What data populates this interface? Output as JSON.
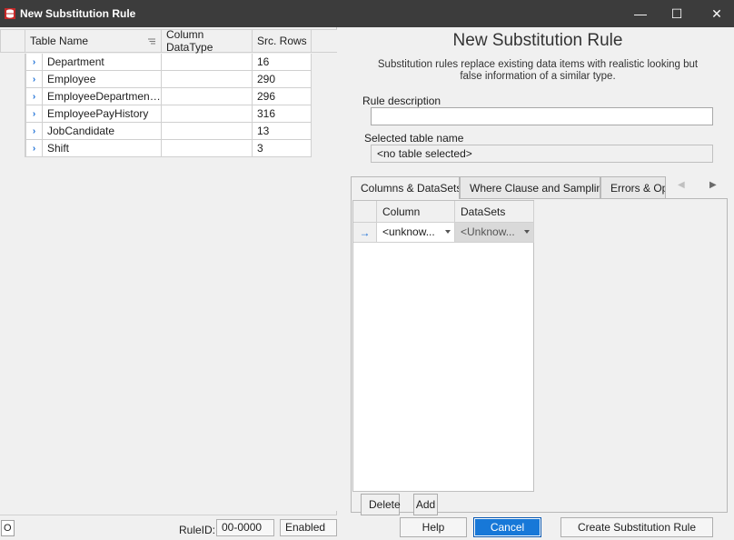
{
  "window": {
    "title": "New Substitution Rule",
    "minimize": "—",
    "maximize": "☐",
    "close": "✕"
  },
  "left_grid": {
    "columns": [
      "Table Name",
      "Column DataType",
      "Src. Rows"
    ],
    "rows": [
      {
        "name": "Department",
        "type": "",
        "rows": "16"
      },
      {
        "name": "Employee",
        "type": "",
        "rows": "290"
      },
      {
        "name": "EmployeeDepartment...",
        "type": "",
        "rows": "296"
      },
      {
        "name": "EmployeePayHistory",
        "type": "",
        "rows": "316"
      },
      {
        "name": "JobCandidate",
        "type": "",
        "rows": "13"
      },
      {
        "name": "Shift",
        "type": "",
        "rows": "3"
      }
    ]
  },
  "statusbar": {
    "o": "O",
    "ruleid_label": "RuleID:",
    "ruleid_value": "00-0000",
    "state": "Enabled"
  },
  "form": {
    "heading": "New Substitution Rule",
    "description": "Substitution rules replace existing data items with realistic looking but false information of a similar type.",
    "rule_description_label": "Rule description",
    "rule_description_value": "",
    "selected_table_label": "Selected table name",
    "selected_table_value": "<no table selected>"
  },
  "tabs": [
    {
      "label": "Columns & DataSets",
      "active": true
    },
    {
      "label": "Where Clause and Sampling",
      "active": false
    },
    {
      "label": "Errors & Options",
      "active": false
    }
  ],
  "tab_nav": {
    "prev": "◀",
    "next": "▶"
  },
  "columns_grid": {
    "headers": [
      "Column",
      "DataSets"
    ],
    "row": {
      "marker": "→",
      "column": "<unknow...",
      "datasets": "<Unknow..."
    }
  },
  "buttons": {
    "delete": "Delete",
    "add": "Add",
    "help": "Help",
    "cancel": "Cancel",
    "create": "Create Substitution Rule"
  }
}
